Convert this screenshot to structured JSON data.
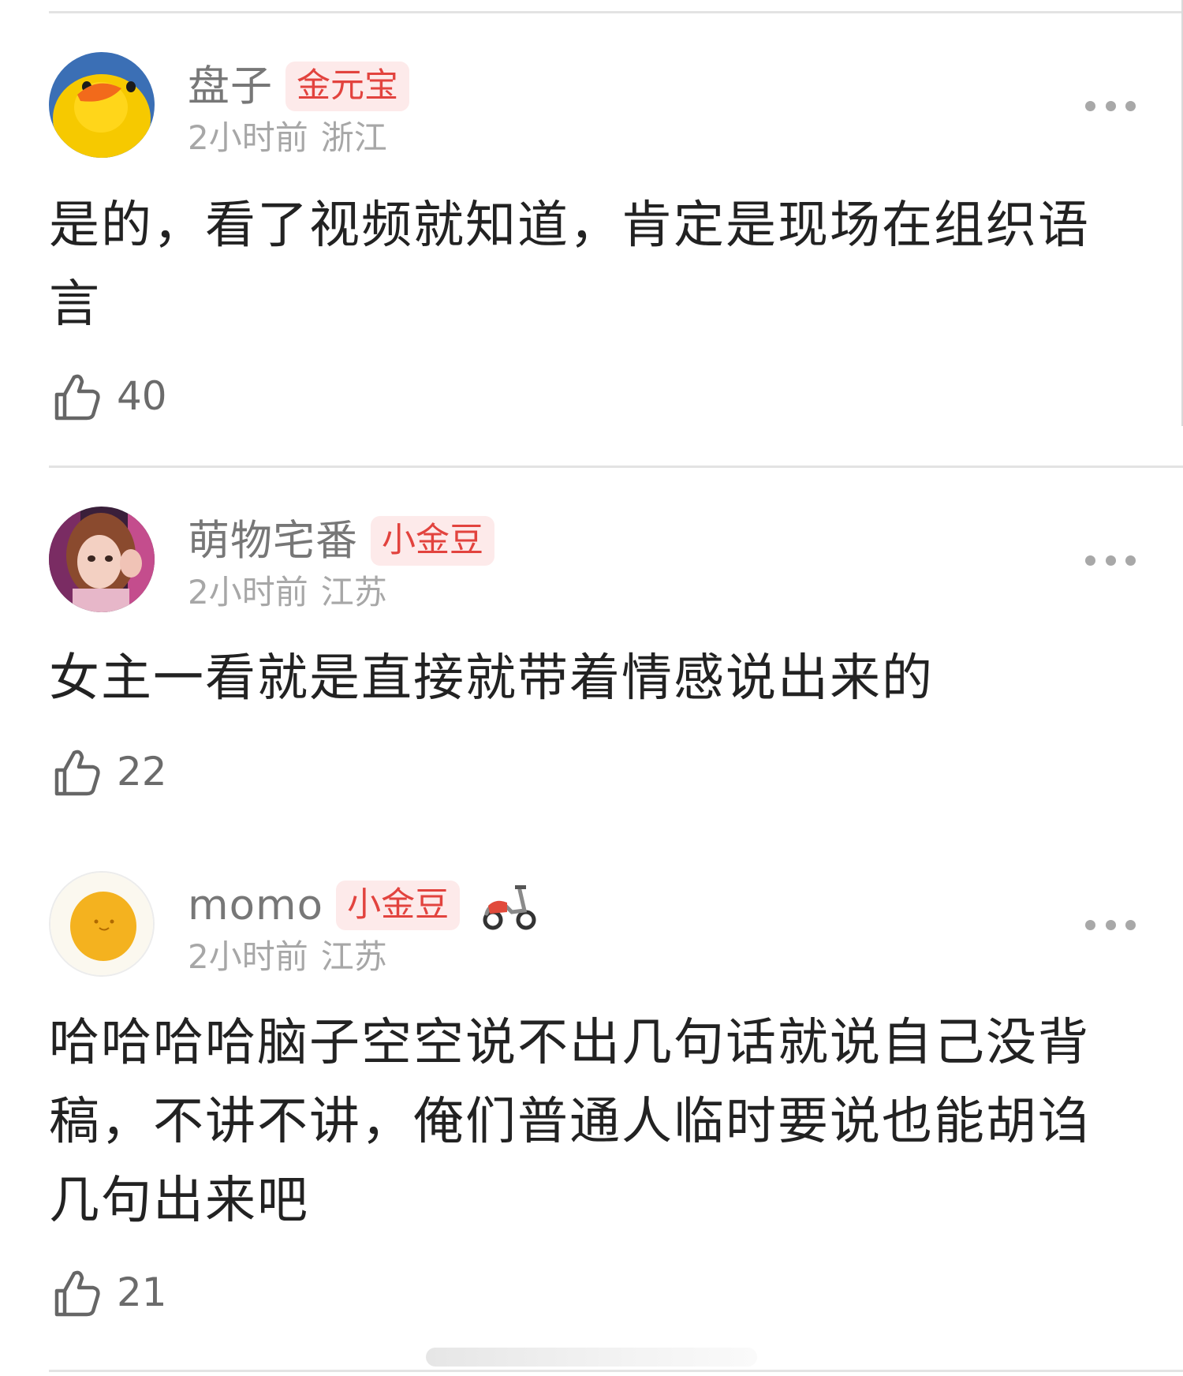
{
  "comments": [
    {
      "username": "盘子",
      "badge": "金元宝",
      "time": "2小时前",
      "location": "浙江",
      "text": "是的，看了视频就知道，肯定是现场在组织语言",
      "likes": "40",
      "avatar_icon": "rubber-duck"
    },
    {
      "username": "萌物宅番",
      "badge": "小金豆",
      "time": "2小时前",
      "location": "江苏",
      "text": "女主一看就是直接就带着情感说出来的",
      "likes": "22",
      "avatar_icon": "girl-photo"
    },
    {
      "username": "momo",
      "badge": "小金豆",
      "badge_extra_icon": "scooter",
      "time": "2小时前",
      "location": "江苏",
      "text": "哈哈哈哈脑子空空说不出几句话就说自己没背稿，不讲不讲，俺们普通人临时要说也能胡诌几句出来吧",
      "likes": "21",
      "avatar_icon": "egg-yolk"
    }
  ],
  "colors": {
    "badge_text": "#e2433e",
    "badge_bg": "#fdeaea",
    "username": "#777777",
    "meta": "#a7a7a7"
  }
}
